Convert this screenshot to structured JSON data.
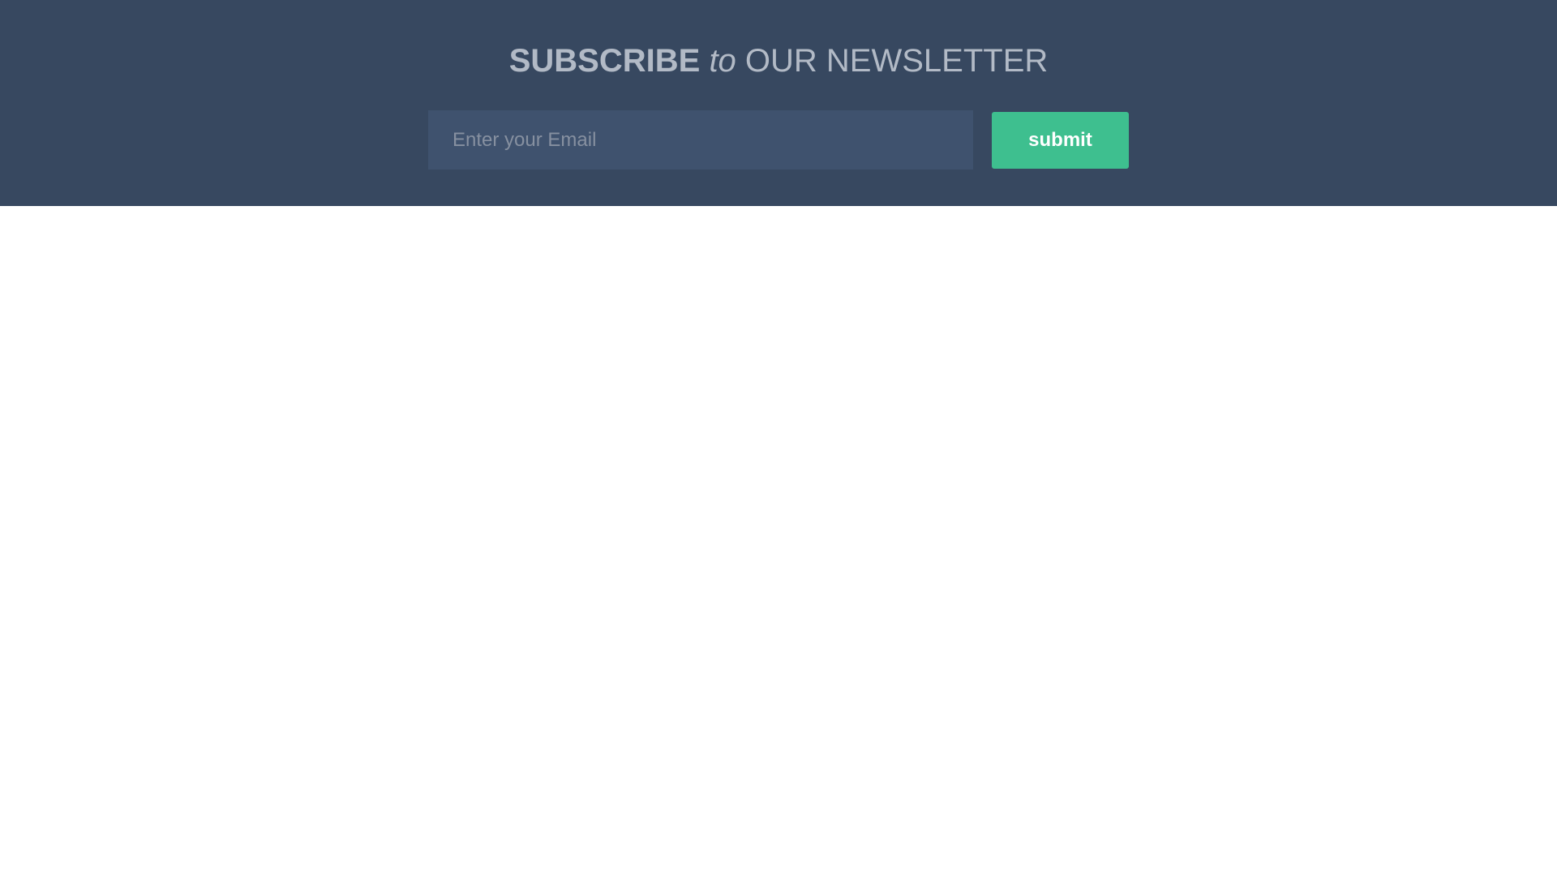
{
  "newsletter": {
    "title_strong": "SUBSCRIBE",
    "title_em": "to",
    "title_rest": "OUR NEWSLETTER",
    "email_placeholder": "Enter your Email",
    "email_value": "",
    "submit_label": "submit"
  },
  "colors": {
    "banner_background": "#374860",
    "input_background": "#3f526e",
    "title_text": "#b2bac6",
    "submit_background": "#3ebf8f",
    "submit_text": "#ffffff",
    "page_background": "#ffffff"
  }
}
